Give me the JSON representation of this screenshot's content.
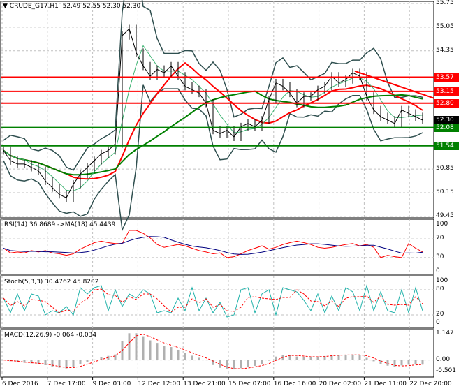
{
  "header": {
    "symbol": "CRUDE_G17,H1",
    "ohlc": "52.49 52.55 52.30 52.30"
  },
  "colors": {
    "red": "#ff0000",
    "green": "#008000",
    "band": "#2f4f4f",
    "ma_navy": "#000080",
    "stoch": "#20b2aa"
  },
  "chart_data": [
    {
      "type": "line",
      "title": "CRUDE_G17,H1",
      "ylim": [
        49.45,
        55.75
      ],
      "y_ticks": [
        "55.75",
        "55.05",
        "54.35",
        "50.85",
        "50.15",
        "49.45"
      ],
      "x_ticks": [
        "6 Dec 2016",
        "7 Dec 17:00",
        "9 Dec 03:00",
        "12 Dec 12:00",
        "13 Dec 21:00",
        "15 Dec 07:00",
        "16 Dec 16:00",
        "20 Dec 02:00",
        "21 Dec 11:00",
        "22 Dec 20:00"
      ],
      "close": [
        51.4,
        51.1,
        51.0,
        51.0,
        50.9,
        50.8,
        50.5,
        50.3,
        50.1,
        50.0,
        50.4,
        50.7,
        50.9,
        51.1,
        51.3,
        51.4,
        51.6,
        54.8,
        55.0,
        54.3,
        53.9,
        53.6,
        53.8,
        53.7,
        53.9,
        53.6,
        53.3,
        53.2,
        53.1,
        52.8,
        52.0,
        51.9,
        52.0,
        51.8,
        52.1,
        52.2,
        52.1,
        52.3,
        52.9,
        53.4,
        53.3,
        53.1,
        52.8,
        53.0,
        53.0,
        53.2,
        53.3,
        53.6,
        53.4,
        53.5,
        53.7,
        53.6,
        53.0,
        52.6,
        52.4,
        52.3,
        52.2,
        52.6,
        52.5,
        52.4,
        52.3
      ],
      "levels": [
        {
          "value": 53.57,
          "label": "53.57",
          "color": "red"
        },
        {
          "value": 53.15,
          "label": "53.15",
          "color": "red"
        },
        {
          "value": 52.8,
          "label": "52.80",
          "color": "red"
        },
        {
          "value": 52.08,
          "label": "52.08",
          "color": "green"
        },
        {
          "value": 51.54,
          "label": "51.54",
          "color": "green"
        }
      ],
      "current_price": {
        "value": 52.3,
        "label": "52.30"
      },
      "trendline": {
        "from": 53.75,
        "to": 52.95
      }
    },
    {
      "type": "line",
      "title": "RSI(14) 36.8689  ->MA(18) 45.4439",
      "ylim": [
        0,
        100
      ],
      "y_ticks": [
        "100",
        "70",
        "30",
        "0"
      ],
      "rsi": [
        50,
        40,
        42,
        40,
        45,
        42,
        45,
        40,
        38,
        35,
        38,
        48,
        55,
        62,
        65,
        62,
        60,
        60,
        88,
        88,
        82,
        72,
        58,
        52,
        55,
        58,
        55,
        50,
        45,
        42,
        38,
        40,
        30,
        32,
        38,
        45,
        50,
        55,
        48,
        52,
        58,
        62,
        65,
        62,
        58,
        52,
        50,
        52,
        55,
        58,
        60,
        55,
        58,
        52,
        30,
        35,
        32,
        30,
        60,
        50,
        42
      ]
    },
    {
      "type": "line",
      "title": "Stoch(5,3,3) 30.4762 45.8202",
      "ylim": [
        0,
        100
      ],
      "y_ticks": [
        "100",
        "80",
        "20",
        "0"
      ],
      "main": [
        60,
        25,
        70,
        30,
        70,
        65,
        20,
        30,
        25,
        40,
        20,
        85,
        70,
        85,
        90,
        30,
        80,
        40,
        70,
        60,
        80,
        70,
        25,
        30,
        25,
        60,
        30,
        85,
        30,
        60,
        25,
        50,
        15,
        20,
        80,
        85,
        25,
        70,
        80,
        20,
        85,
        80,
        75,
        55,
        30,
        70,
        25,
        65,
        30,
        85,
        75,
        30,
        90,
        30,
        75,
        30,
        25,
        80,
        25,
        85,
        30
      ]
    },
    {
      "type": "bar",
      "title": "MACD(12,26,9) -0.064 -0.034",
      "ylim": [
        -0.501,
        1.147
      ],
      "y_ticks": [
        "1.147",
        "0.00",
        "-0.501"
      ]
    }
  ]
}
